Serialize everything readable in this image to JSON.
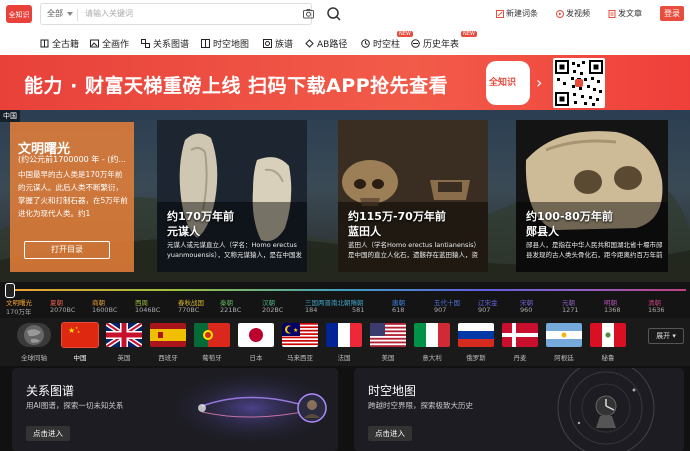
{
  "header": {
    "logo_text": "全知识",
    "search": {
      "scope": "全部",
      "placeholder": "请输入关键词"
    },
    "actions": [
      {
        "label": "新建词条",
        "icon": "edit-icon"
      },
      {
        "label": "发视频",
        "icon": "video-icon"
      },
      {
        "label": "发文章",
        "icon": "article-icon"
      }
    ],
    "login_label": "登录"
  },
  "nav": [
    {
      "label": "全古籍",
      "icon": "book-icon"
    },
    {
      "label": "全画作",
      "icon": "painting-icon"
    },
    {
      "label": "关系图谱",
      "icon": "graph-icon"
    },
    {
      "label": "时空地图",
      "icon": "map-icon"
    },
    {
      "label": "族谱",
      "icon": "family-icon"
    },
    {
      "label": "AB路径",
      "icon": "path-icon"
    },
    {
      "label": "时空柱",
      "icon": "pillar-icon",
      "badge": "NEW"
    },
    {
      "label": "历史年表",
      "icon": "timeline-icon",
      "badge": "NEW"
    }
  ],
  "banner": {
    "text": "能力 · 财富天梯重磅上线 扫码下载APP抢先查看",
    "app_label": "全知识"
  },
  "hero": {
    "region_tag": "中国",
    "intro": {
      "title": "文明曙光",
      "subtitle": "(约公元前1700000 年 - (约...",
      "text": "中国最早的古人类是170万年前的元谋人。此后人类不断繁衍，掌握了火和打制石器，在5万年前进化为现代人类。约1",
      "button": "打开目录"
    },
    "cards": [
      {
        "time": "约170万年前",
        "name": "元谋人",
        "desc": "元谋人或元谋直立人（学名：Homo erectus yuanmouensis），又称元谋猿人，是在中国发"
      },
      {
        "time": "约115万-70万年前",
        "name": "蓝田人",
        "desc": "蓝田人（学名Homo erectus lantianensis）是中国的直立人化石，遗骸存在蓝田猿人，资"
      },
      {
        "time": "约100-80万年前",
        "name": "郧县人",
        "desc": "郧县人，是指在中华人民共和国湖北省十堰市郧县发现的古人类头骨化石，距今距离约百万年前"
      }
    ]
  },
  "timeline": {
    "eras": [
      {
        "name": "文明曙光",
        "year": "170万年",
        "color": "#f0a030"
      },
      {
        "name": "夏朝",
        "year": "2070BC",
        "color": "#e8604a"
      },
      {
        "name": "商朝",
        "year": "1600BC",
        "color": "#e0a030"
      },
      {
        "name": "西周",
        "year": "1046BC",
        "color": "#9bc040"
      },
      {
        "name": "春秋战国",
        "year": "770BC",
        "color": "#d8b830"
      },
      {
        "name": "秦朝",
        "year": "221BC",
        "color": "#60b060"
      },
      {
        "name": "汉朝",
        "year": "202BC",
        "color": "#50b080"
      },
      {
        "name": "三国两晋南北朝隋朝",
        "year": "184",
        "color": "#40a0c0"
      },
      {
        "name": "",
        "year": "581",
        "color": "#4090d0"
      },
      {
        "name": "唐朝",
        "year": "618",
        "color": "#4080e0"
      },
      {
        "name": "五代十国",
        "year": "907",
        "color": "#5070e0"
      },
      {
        "name": "辽宋金",
        "year": "907",
        "color": "#6060e0"
      },
      {
        "name": "宋朝",
        "year": "960",
        "color": "#7060d0"
      },
      {
        "name": "元朝",
        "year": "1271",
        "color": "#9060c0"
      },
      {
        "name": "明朝",
        "year": "1368",
        "color": "#b050b0"
      },
      {
        "name": "清朝",
        "year": "1636",
        "color": "#c04080"
      }
    ]
  },
  "countries": {
    "items": [
      {
        "label": "全球同轴"
      },
      {
        "label": "中国"
      },
      {
        "label": "英国"
      },
      {
        "label": "西班牙"
      },
      {
        "label": "葡萄牙"
      },
      {
        "label": "日本"
      },
      {
        "label": "马来西亚"
      },
      {
        "label": "法国"
      },
      {
        "label": "美国"
      },
      {
        "label": "意大利"
      },
      {
        "label": "俄罗斯"
      },
      {
        "label": "丹麦"
      },
      {
        "label": "阿根廷"
      },
      {
        "label": "秘鲁"
      }
    ],
    "expand_label": "展开"
  },
  "panels": [
    {
      "title": "关系图谱",
      "subtitle": "用AI图谱，探索一切未知关系",
      "button": "点击进入"
    },
    {
      "title": "时空地图",
      "subtitle": "跨越时空界限，探索极致大历史",
      "button": "点击进入"
    }
  ]
}
